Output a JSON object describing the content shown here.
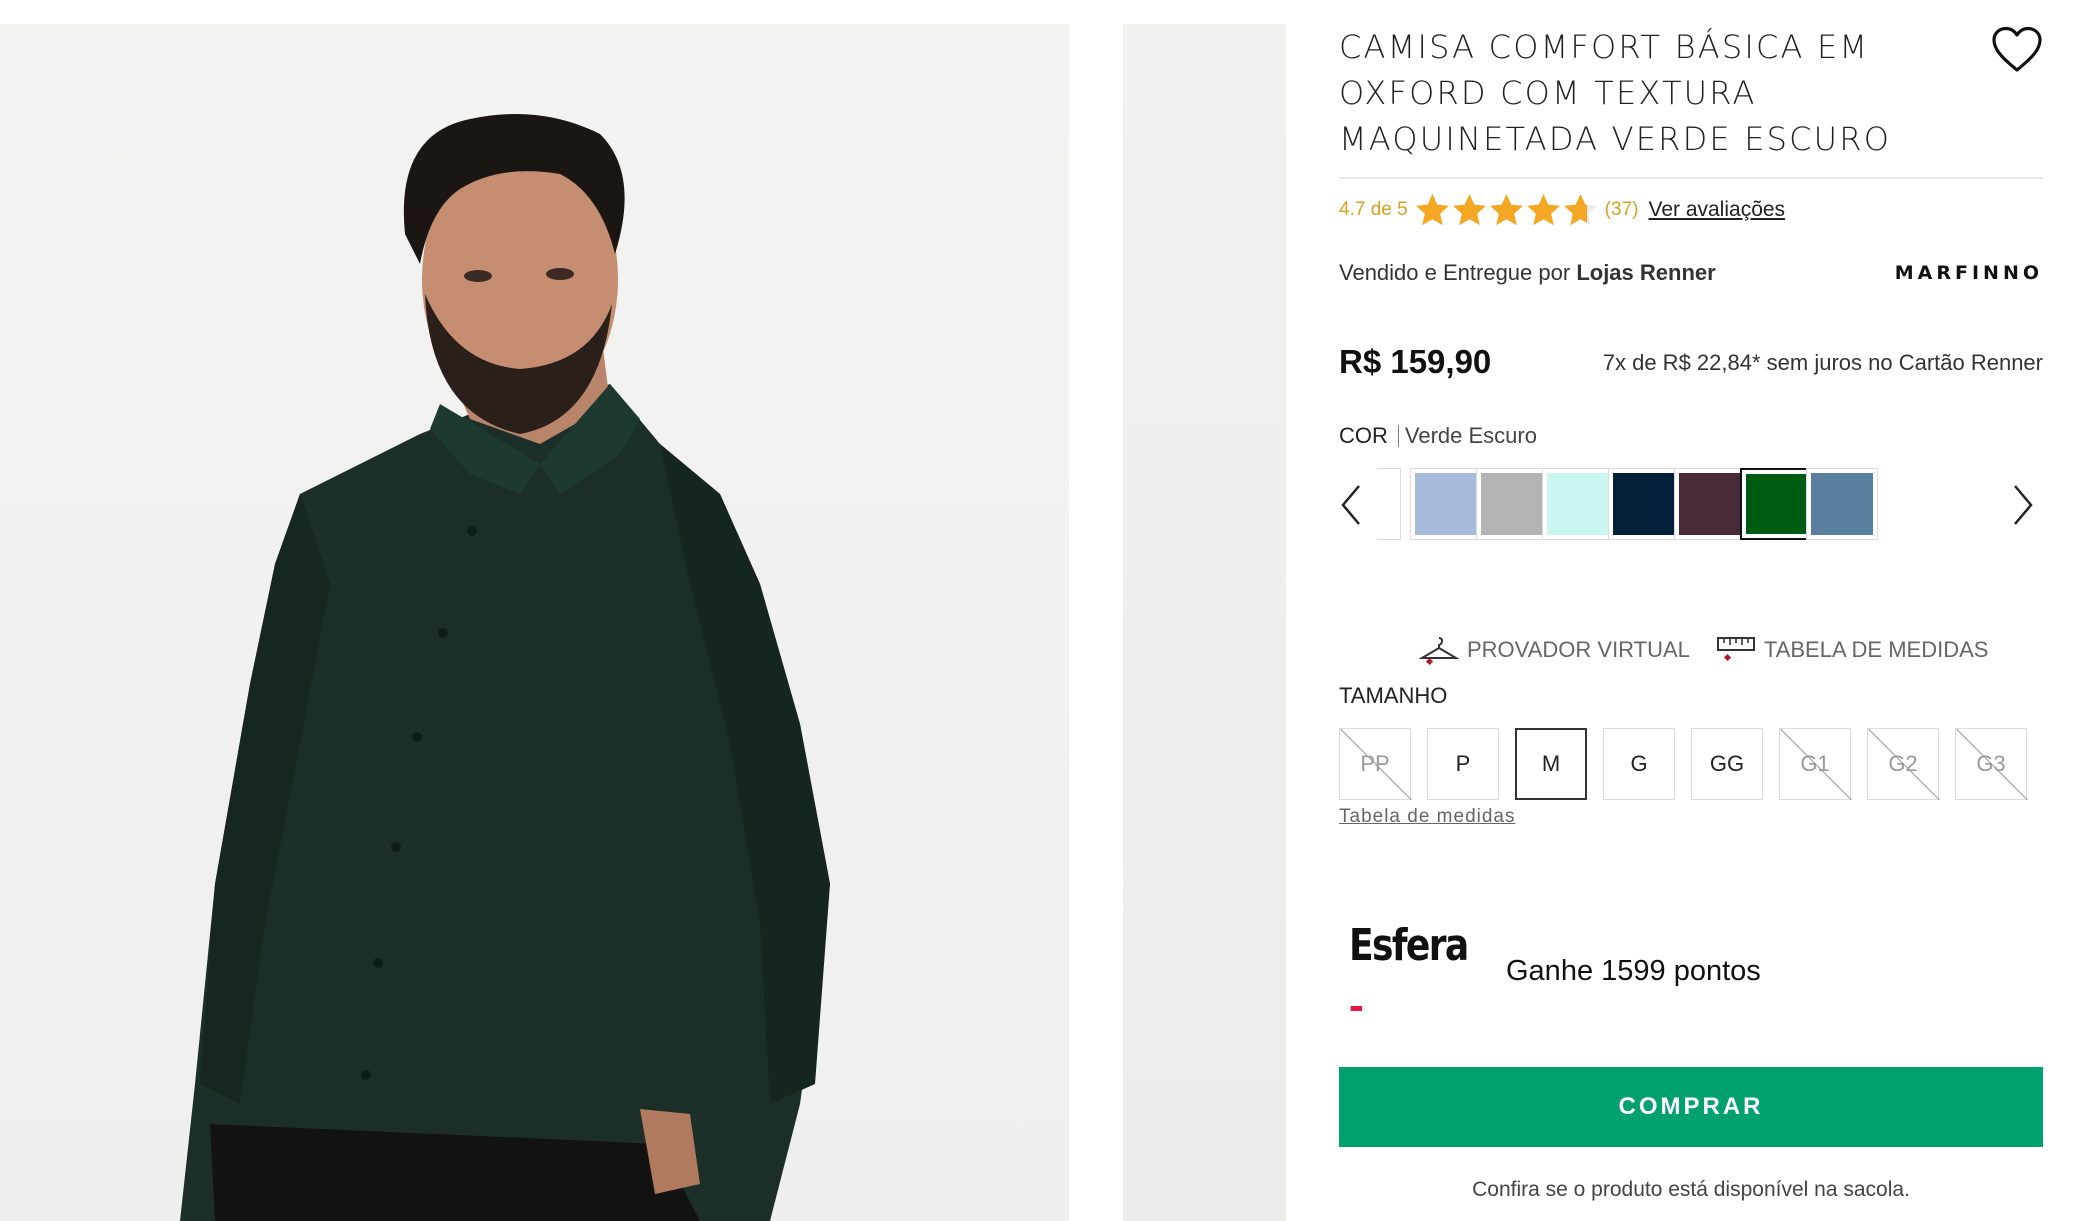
{
  "product": {
    "title": "CAMISA COMFORT BÁSICA EM OXFORD COM TEXTURA MAQUINETADA VERDE ESCURO",
    "favorite_icon": "heart-outline-icon"
  },
  "rating": {
    "text": "4.7 de 5",
    "value": 4.7,
    "max": 5,
    "count": "(37)",
    "link": "Ver avaliações",
    "star_color": "#f5a623"
  },
  "seller": {
    "prefix": "Vendido e Entregue por",
    "name": "Lojas Renner",
    "brand": "MARFINNO"
  },
  "pricing": {
    "price": "R$ 159,90",
    "installments": "7x de R$ 22,84* sem juros no Cartão Renner"
  },
  "color": {
    "label": "COR",
    "selected": "Verde Escuro",
    "swatches": [
      {
        "name": "Branco",
        "hex": "#ffffff"
      },
      {
        "name": "Azul Claro",
        "hex": "#a6bbdc"
      },
      {
        "name": "Cinza",
        "hex": "#b3b3b3"
      },
      {
        "name": "Verde Água",
        "hex": "#cbf5f1"
      },
      {
        "name": "Azul Marinho",
        "hex": "#041f38"
      },
      {
        "name": "Bordô",
        "hex": "#482a3b"
      },
      {
        "name": "Verde Escuro",
        "hex": "#005c12"
      },
      {
        "name": "Azul Acinzentado",
        "hex": "#5a7fa0"
      }
    ],
    "prev_icon": "chevron-left-icon",
    "next_icon": "chevron-right-icon"
  },
  "tools": {
    "virtual_fitting": "PROVADOR VIRTUAL",
    "size_chart": "TABELA DE MEDIDAS"
  },
  "size": {
    "label": "TAMANHO",
    "options": [
      {
        "label": "PP",
        "available": false
      },
      {
        "label": "P",
        "available": true
      },
      {
        "label": "M",
        "available": true,
        "selected": true
      },
      {
        "label": "G",
        "available": true
      },
      {
        "label": "GG",
        "available": true
      },
      {
        "label": "G1",
        "available": false
      },
      {
        "label": "G2",
        "available": false
      },
      {
        "label": "G3",
        "available": false
      }
    ],
    "chart_link": "Tabela de medidas"
  },
  "loyalty": {
    "logo": "Esfera",
    "points": "Ganhe 1599 pontos"
  },
  "actions": {
    "buy": "COMPRAR",
    "availability_note": "Confira se o produto está disponível na sacola."
  },
  "colors": {
    "buy_button": "#00a070",
    "rating": "#d9a21e",
    "esfera_accent": "#e5173f"
  }
}
